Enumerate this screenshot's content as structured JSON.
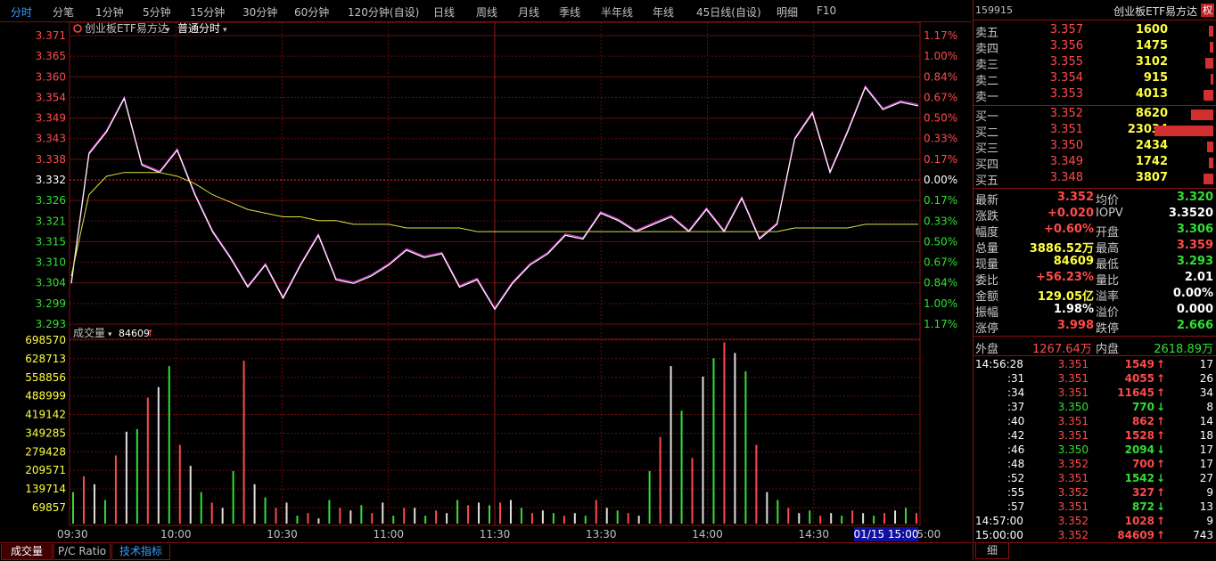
{
  "toolbar": {
    "tabs": [
      "分时",
      "分笔",
      "1分钟",
      "5分钟",
      "15分钟",
      "30分钟",
      "60分钟",
      "120分钟(自设)",
      "日线",
      "周线",
      "月线",
      "季线",
      "半年线",
      "年线",
      "45日线(自设)",
      "明细",
      "F10"
    ]
  },
  "price_chart": {
    "title": "创业板ETF易方达",
    "mode": "普通分时",
    "y_left": [
      "3.371",
      "3.365",
      "3.360",
      "3.354",
      "3.349",
      "3.343",
      "3.338",
      "3.332",
      "3.326",
      "3.321",
      "3.315",
      "3.310",
      "3.304",
      "3.299",
      "3.293"
    ],
    "y_right": [
      "1.17%",
      "1.00%",
      "0.84%",
      "0.67%",
      "0.50%",
      "0.33%",
      "0.17%",
      "0.00%",
      "0.17%",
      "0.33%",
      "0.50%",
      "0.67%",
      "0.84%",
      "1.00%",
      "1.17%"
    ]
  },
  "volume_chart": {
    "label": "成交量",
    "current": "84609",
    "y_labels": [
      "698570",
      "628713",
      "558856",
      "488999",
      "419142",
      "349285",
      "279428",
      "209571",
      "139714",
      "69857"
    ]
  },
  "x_axis": [
    "09:30",
    "10:00",
    "10:30",
    "11:00",
    "11:30",
    "13:30",
    "14:00",
    "14:30",
    "15:00"
  ],
  "cursor_time": "01/15 15:00",
  "chart_data": [
    {
      "type": "line",
      "title": "",
      "xlabel": "",
      "ylabel": "",
      "ylim": [
        3.293,
        3.371
      ],
      "x": [
        "09:30",
        "09:35",
        "09:40",
        "09:45",
        "09:50",
        "09:55",
        "10:00",
        "10:05",
        "10:10",
        "10:15",
        "10:20",
        "10:25",
        "10:30",
        "10:35",
        "10:40",
        "10:45",
        "10:50",
        "10:55",
        "11:00",
        "11:05",
        "11:10",
        "11:15",
        "11:20",
        "11:25",
        "11:30",
        "13:05",
        "13:10",
        "13:15",
        "13:20",
        "13:25",
        "13:30",
        "13:35",
        "13:40",
        "13:45",
        "13:50",
        "13:55",
        "14:00",
        "14:05",
        "14:10",
        "14:15",
        "14:20",
        "14:25",
        "14:30",
        "14:35",
        "14:40",
        "14:45",
        "14:50",
        "14:55",
        "15:00"
      ],
      "series": [
        {
          "values": [
            3.304,
            3.339,
            3.345,
            3.354,
            3.336,
            3.334,
            3.34,
            3.328,
            3.318,
            3.311,
            3.303,
            3.309,
            3.3,
            3.309,
            3.317,
            3.305,
            3.304,
            3.306,
            3.309,
            3.313,
            3.311,
            3.312,
            3.303,
            3.305,
            3.297,
            3.304,
            3.309,
            3.312,
            3.317,
            3.316,
            3.323,
            3.321,
            3.318,
            3.32,
            3.322,
            3.318,
            3.324,
            3.318,
            3.327,
            3.316,
            3.32,
            3.343,
            3.35,
            3.334,
            3.345,
            3.357,
            3.351,
            3.353,
            3.352
          ]
        },
        {
          "values": [
            3.306,
            3.328,
            3.333,
            3.334,
            3.334,
            3.334,
            3.333,
            3.331,
            3.328,
            3.326,
            3.324,
            3.323,
            3.322,
            3.322,
            3.321,
            3.321,
            3.32,
            3.32,
            3.32,
            3.319,
            3.319,
            3.319,
            3.319,
            3.318,
            3.318,
            3.318,
            3.318,
            3.318,
            3.318,
            3.318,
            3.318,
            3.318,
            3.318,
            3.318,
            3.318,
            3.318,
            3.318,
            3.318,
            3.318,
            3.318,
            3.318,
            3.319,
            3.319,
            3.319,
            3.319,
            3.32,
            3.32,
            3.32,
            3.32
          ]
        }
      ]
    },
    {
      "type": "bar",
      "title": "成交量",
      "ylim": [
        0,
        698570
      ],
      "values": [
        120000,
        180000,
        150000,
        90000,
        260000,
        350000,
        360000,
        480000,
        520000,
        600000,
        300000,
        220000,
        120000,
        80000,
        60000,
        200000,
        620000,
        150000,
        100000,
        60000,
        80000,
        30000,
        40000,
        20000,
        90000,
        60000,
        50000,
        70000,
        40000,
        80000,
        30000,
        60000,
        60000,
        30000,
        50000,
        40000,
        90000,
        70000,
        80000,
        70000,
        80000,
        90000,
        60000,
        40000,
        50000,
        40000,
        30000,
        40000,
        30000,
        90000,
        60000,
        50000,
        40000,
        30000,
        200000,
        330000,
        600000,
        430000,
        250000,
        560000,
        630000,
        690000,
        650000,
        580000,
        300000,
        120000,
        90000,
        60000,
        40000,
        50000,
        30000,
        40000,
        30000,
        50000,
        40000,
        30000,
        40000,
        50000,
        60000,
        40000
      ]
    }
  ],
  "right_panel": {
    "code": "159915",
    "name": "创业板ETF易方达",
    "right_badge": "权",
    "asks": [
      {
        "label": "卖五",
        "price": "3.357",
        "vol": "1600"
      },
      {
        "label": "卖四",
        "price": "3.356",
        "vol": "1475"
      },
      {
        "label": "卖三",
        "price": "3.355",
        "vol": "3102"
      },
      {
        "label": "卖二",
        "price": "3.354",
        "vol": "915"
      },
      {
        "label": "卖一",
        "price": "3.353",
        "vol": "4013"
      }
    ],
    "bids": [
      {
        "label": "买一",
        "price": "3.352",
        "vol": "8620"
      },
      {
        "label": "买二",
        "price": "3.351",
        "vol": "23034"
      },
      {
        "label": "买三",
        "price": "3.350",
        "vol": "2434"
      },
      {
        "label": "买四",
        "price": "3.349",
        "vol": "1742"
      },
      {
        "label": "买五",
        "price": "3.348",
        "vol": "3807"
      }
    ],
    "stats": [
      {
        "l1": "最新",
        "v1": "3.352",
        "l2": "均价",
        "v2": "3.320"
      },
      {
        "l1": "涨跌",
        "v1": "+0.020",
        "l2": "IOPV",
        "v2": "3.3520"
      },
      {
        "l1": "幅度",
        "v1": "+0.60%",
        "l2": "开盘",
        "v2": "3.306"
      },
      {
        "l1": "总量",
        "v1": "3886.52万",
        "l2": "最高",
        "v2": "3.359"
      },
      {
        "l1": "现量",
        "v1": "84609",
        "l2": "最低",
        "v2": "3.293"
      },
      {
        "l1": "委比",
        "v1": "+56.23%",
        "l2": "量比",
        "v2": "2.01"
      },
      {
        "l1": "金额",
        "v1": "129.05亿",
        "l2": "溢率",
        "v2": "0.00%"
      },
      {
        "l1": "振幅",
        "v1": "1.98%",
        "l2": "溢价",
        "v2": "0.000"
      },
      {
        "l1": "涨停",
        "v1": "3.998",
        "l2": "跌停",
        "v2": "2.666"
      }
    ],
    "outer_label": "外盘",
    "outer_value": "1267.64万",
    "inner_label": "内盘",
    "inner_value": "2618.89万",
    "ticks": [
      {
        "t": "14:56:28",
        "p": "3.351",
        "v": "1549",
        "d": "↑",
        "n": "17"
      },
      {
        "t": ":31",
        "p": "3.351",
        "v": "4055",
        "d": "↑",
        "n": "26"
      },
      {
        "t": ":34",
        "p": "3.351",
        "v": "11645",
        "d": "↑",
        "n": "34"
      },
      {
        "t": ":37",
        "p": "3.350",
        "v": "770",
        "d": "↓",
        "n": "8"
      },
      {
        "t": ":40",
        "p": "3.351",
        "v": "862",
        "d": "↑",
        "n": "14"
      },
      {
        "t": ":42",
        "p": "3.351",
        "v": "1528",
        "d": "↑",
        "n": "18"
      },
      {
        "t": ":46",
        "p": "3.350",
        "v": "2094",
        "d": "↓",
        "n": "17"
      },
      {
        "t": ":48",
        "p": "3.352",
        "v": "700",
        "d": "↑",
        "n": "17"
      },
      {
        "t": ":52",
        "p": "3.351",
        "v": "1542",
        "d": "↓",
        "n": "27"
      },
      {
        "t": ":55",
        "p": "3.352",
        "v": "327",
        "d": "↑",
        "n": "9"
      },
      {
        "t": ":57",
        "p": "3.351",
        "v": "872",
        "d": "↓",
        "n": "13"
      },
      {
        "t": "14:57:00",
        "p": "3.352",
        "v": "1028",
        "d": "↑",
        "n": "9"
      },
      {
        "t": "15:00:00",
        "p": "3.352",
        "v": "84609",
        "d": "↑",
        "n": "743"
      }
    ],
    "bottom_tab": "细"
  },
  "bottom_tabs": [
    "成交量",
    "P/C Ratio",
    "技术指标"
  ]
}
